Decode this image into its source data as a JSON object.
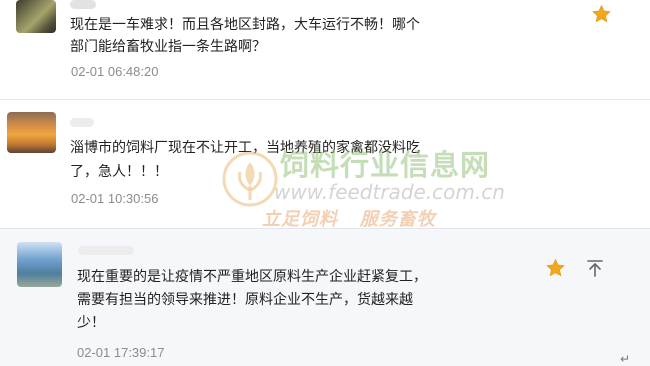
{
  "comments": [
    {
      "text": "现在是一车难求！而且各地区封路，大车运行不畅！哪个\n部门能给畜牧业指一条生路啊？",
      "time": "02-01 06:48:20",
      "icons": [
        "star-icon"
      ]
    },
    {
      "text": "淄博市的饲料厂现在不让开工，当地养殖的家禽都没料吃\n了，急人！！！",
      "time": "02-01 10:30:56",
      "icons": []
    },
    {
      "text": "现在重要的是让疫情不严重地区原料生产企业赶紧复工，\n需要有担当的领导来推进！原料企业不生产，货越来越\n少！",
      "time": "02-01 17:39:17",
      "icons": [
        "star-icon",
        "pin-top-icon"
      ]
    }
  ],
  "watermark": {
    "title": "饲料行业信息网",
    "url": "www.feedtrade.com.cn",
    "slogan": "立足饲料   服务畜牧"
  },
  "colors": {
    "star": "#f2a81d",
    "text": "#222222",
    "time": "#8c8c8c",
    "highlight_bg": "#f6f7fa"
  },
  "return_mark": "↵"
}
